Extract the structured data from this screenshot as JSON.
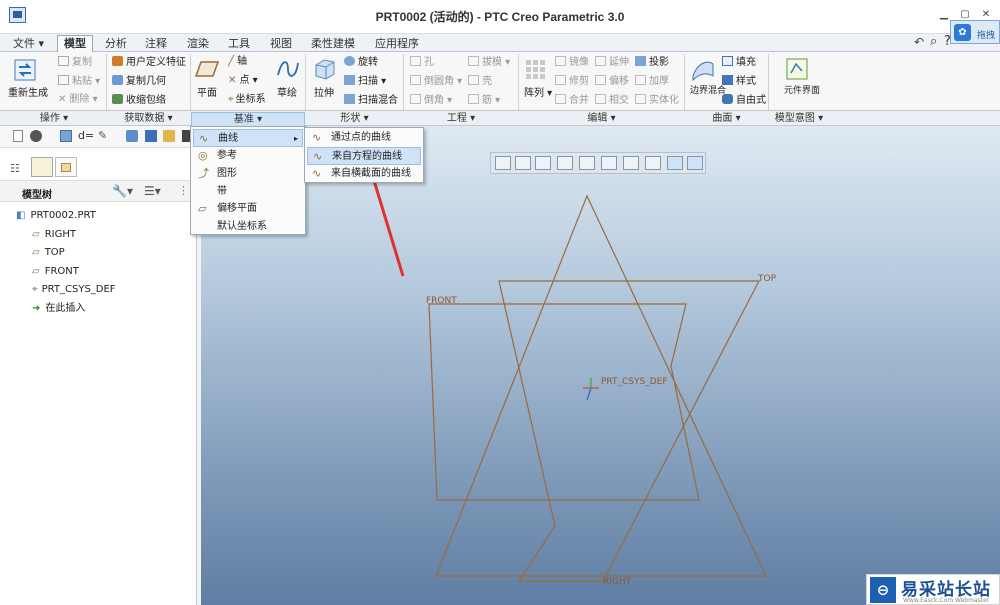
{
  "window": {
    "title": "PRT0002 (活动的) - PTC Creo Parametric 3.0"
  },
  "menubar": {
    "tabs": [
      "文件",
      "模型",
      "分析",
      "注释",
      "渲染",
      "工具",
      "视图",
      "柔性建模",
      "应用程序"
    ],
    "active": "模型"
  },
  "ribbon": {
    "regenerate": "重新生成",
    "copy": "复制",
    "paste": "粘贴",
    "delete": "删除",
    "udf": "用户定义特征",
    "copy_geom": "复制几何",
    "shrinkwrap": "收缩包络",
    "plane": "平面",
    "axis": "轴",
    "point": "点",
    "csys": "坐标系",
    "sketch": "草绘",
    "extrude": "拉伸",
    "revolve": "旋转",
    "sweep": "扫描",
    "swept_blend": "扫描混合",
    "hole": "孔",
    "round": "倒圆角",
    "chamfer": "倒角",
    "draft": "拔模",
    "shell": "壳",
    "rib": "筋",
    "pattern": "阵列",
    "mirror": "镜像",
    "trim": "修剪",
    "merge": "合并",
    "extend": "延伸",
    "offset": "偏移",
    "intersect": "相交",
    "project": "投影",
    "thicken": "加厚",
    "solidify": "实体化",
    "boundary_blend": "边界混合",
    "fill": "填充",
    "style": "样式",
    "freestyle": "自由式",
    "component_interface": "元件界面"
  },
  "groups": [
    "操作",
    "获取数据",
    "基准",
    "形状",
    "工程",
    "编辑",
    "曲面",
    "模型意图"
  ],
  "panel": {
    "title": "模型树"
  },
  "tree": {
    "items": [
      "PRT0002.PRT",
      "RIGHT",
      "TOP",
      "FRONT",
      "PRT_CSYS_DEF",
      "在此插入"
    ]
  },
  "datum_menu": {
    "items": [
      "曲线",
      "参考",
      "图形",
      "带",
      "偏移平面",
      "默认坐标系"
    ]
  },
  "curve_submenu": {
    "items": [
      "通过点的曲线",
      "来自方程的曲线",
      "来自横截面的曲线"
    ]
  },
  "viewport": {
    "labels": {
      "top": "TOP",
      "front": "FRONT",
      "right": "RIGHT",
      "csys": "PRT_CSYS_DEF"
    }
  },
  "top_right": {
    "share_label": "拖拽"
  },
  "watermark": {
    "text": "易采站长站",
    "sub": "Www.Easck.Com Webmaster"
  },
  "colors": {
    "datum": "#9a6a3e",
    "highlight": "#cfe2f6",
    "arrow": "#e0302f",
    "viewport_top": "#dfe9f3",
    "viewport_bottom": "#5f7ea3"
  }
}
